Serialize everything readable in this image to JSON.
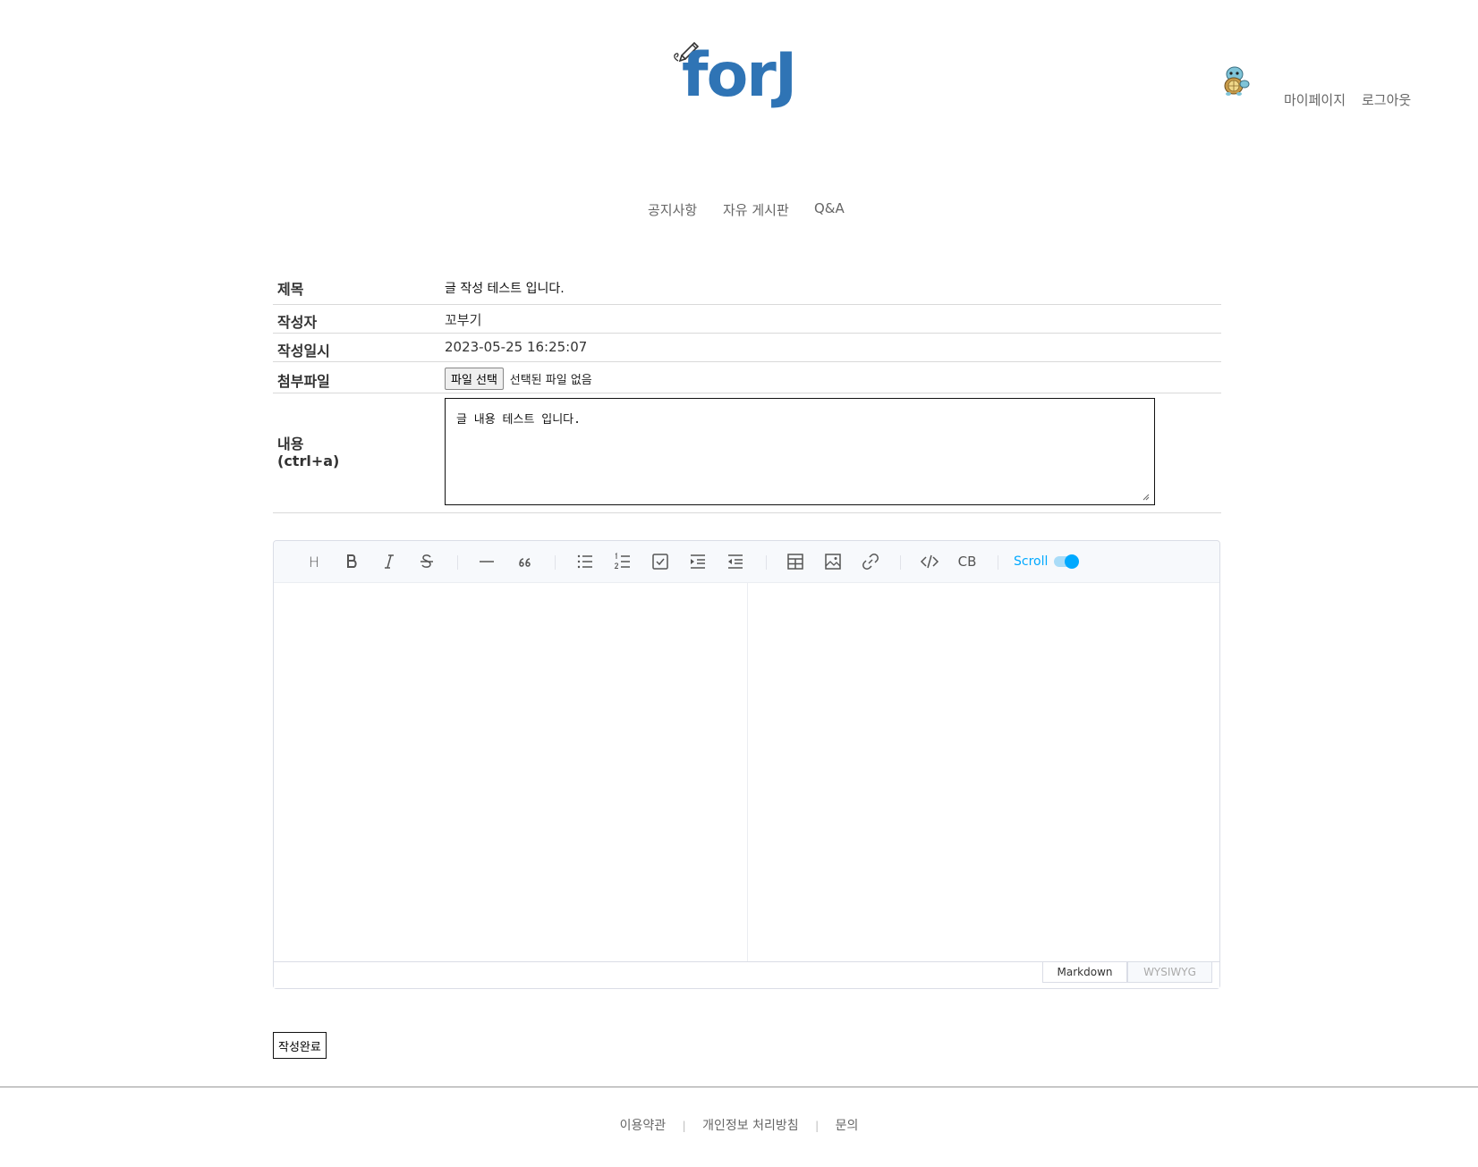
{
  "header": {
    "logo_text": "forJ",
    "mypage_label": "마이페이지",
    "logout_label": "로그아웃"
  },
  "nav": {
    "items": [
      "공지사항",
      "자유 게시판",
      "Q&A"
    ]
  },
  "form": {
    "title_label": "제목",
    "title_value": "글 작성 테스트 입니다.",
    "author_label": "작성자",
    "author_value": "꼬부기",
    "date_label": "작성일시",
    "date_value": "2023-05-25 16:25:07",
    "file_label": "첨부파일",
    "file_button": "파일 선택",
    "file_status": "선택된 파일 없음",
    "content_label": "내용",
    "content_hint": "(ctrl+a)",
    "content_value": "글 내용 테스트 입니다."
  },
  "editor": {
    "toolbar": {
      "heading": "H",
      "codeblock": "CB",
      "scroll_label": "Scroll"
    },
    "scroll_sync_on": true,
    "accent_color": "#00a9ff",
    "modes": [
      "Markdown",
      "WYSIWYG"
    ],
    "active_mode": "Markdown"
  },
  "submit_label": "작성완료",
  "footer": {
    "links": [
      "이용약관",
      "개인정보 처리방침",
      "문의"
    ],
    "separator": "|"
  },
  "colors": {
    "brand": "#2f74b5",
    "text_muted": "#666666"
  }
}
